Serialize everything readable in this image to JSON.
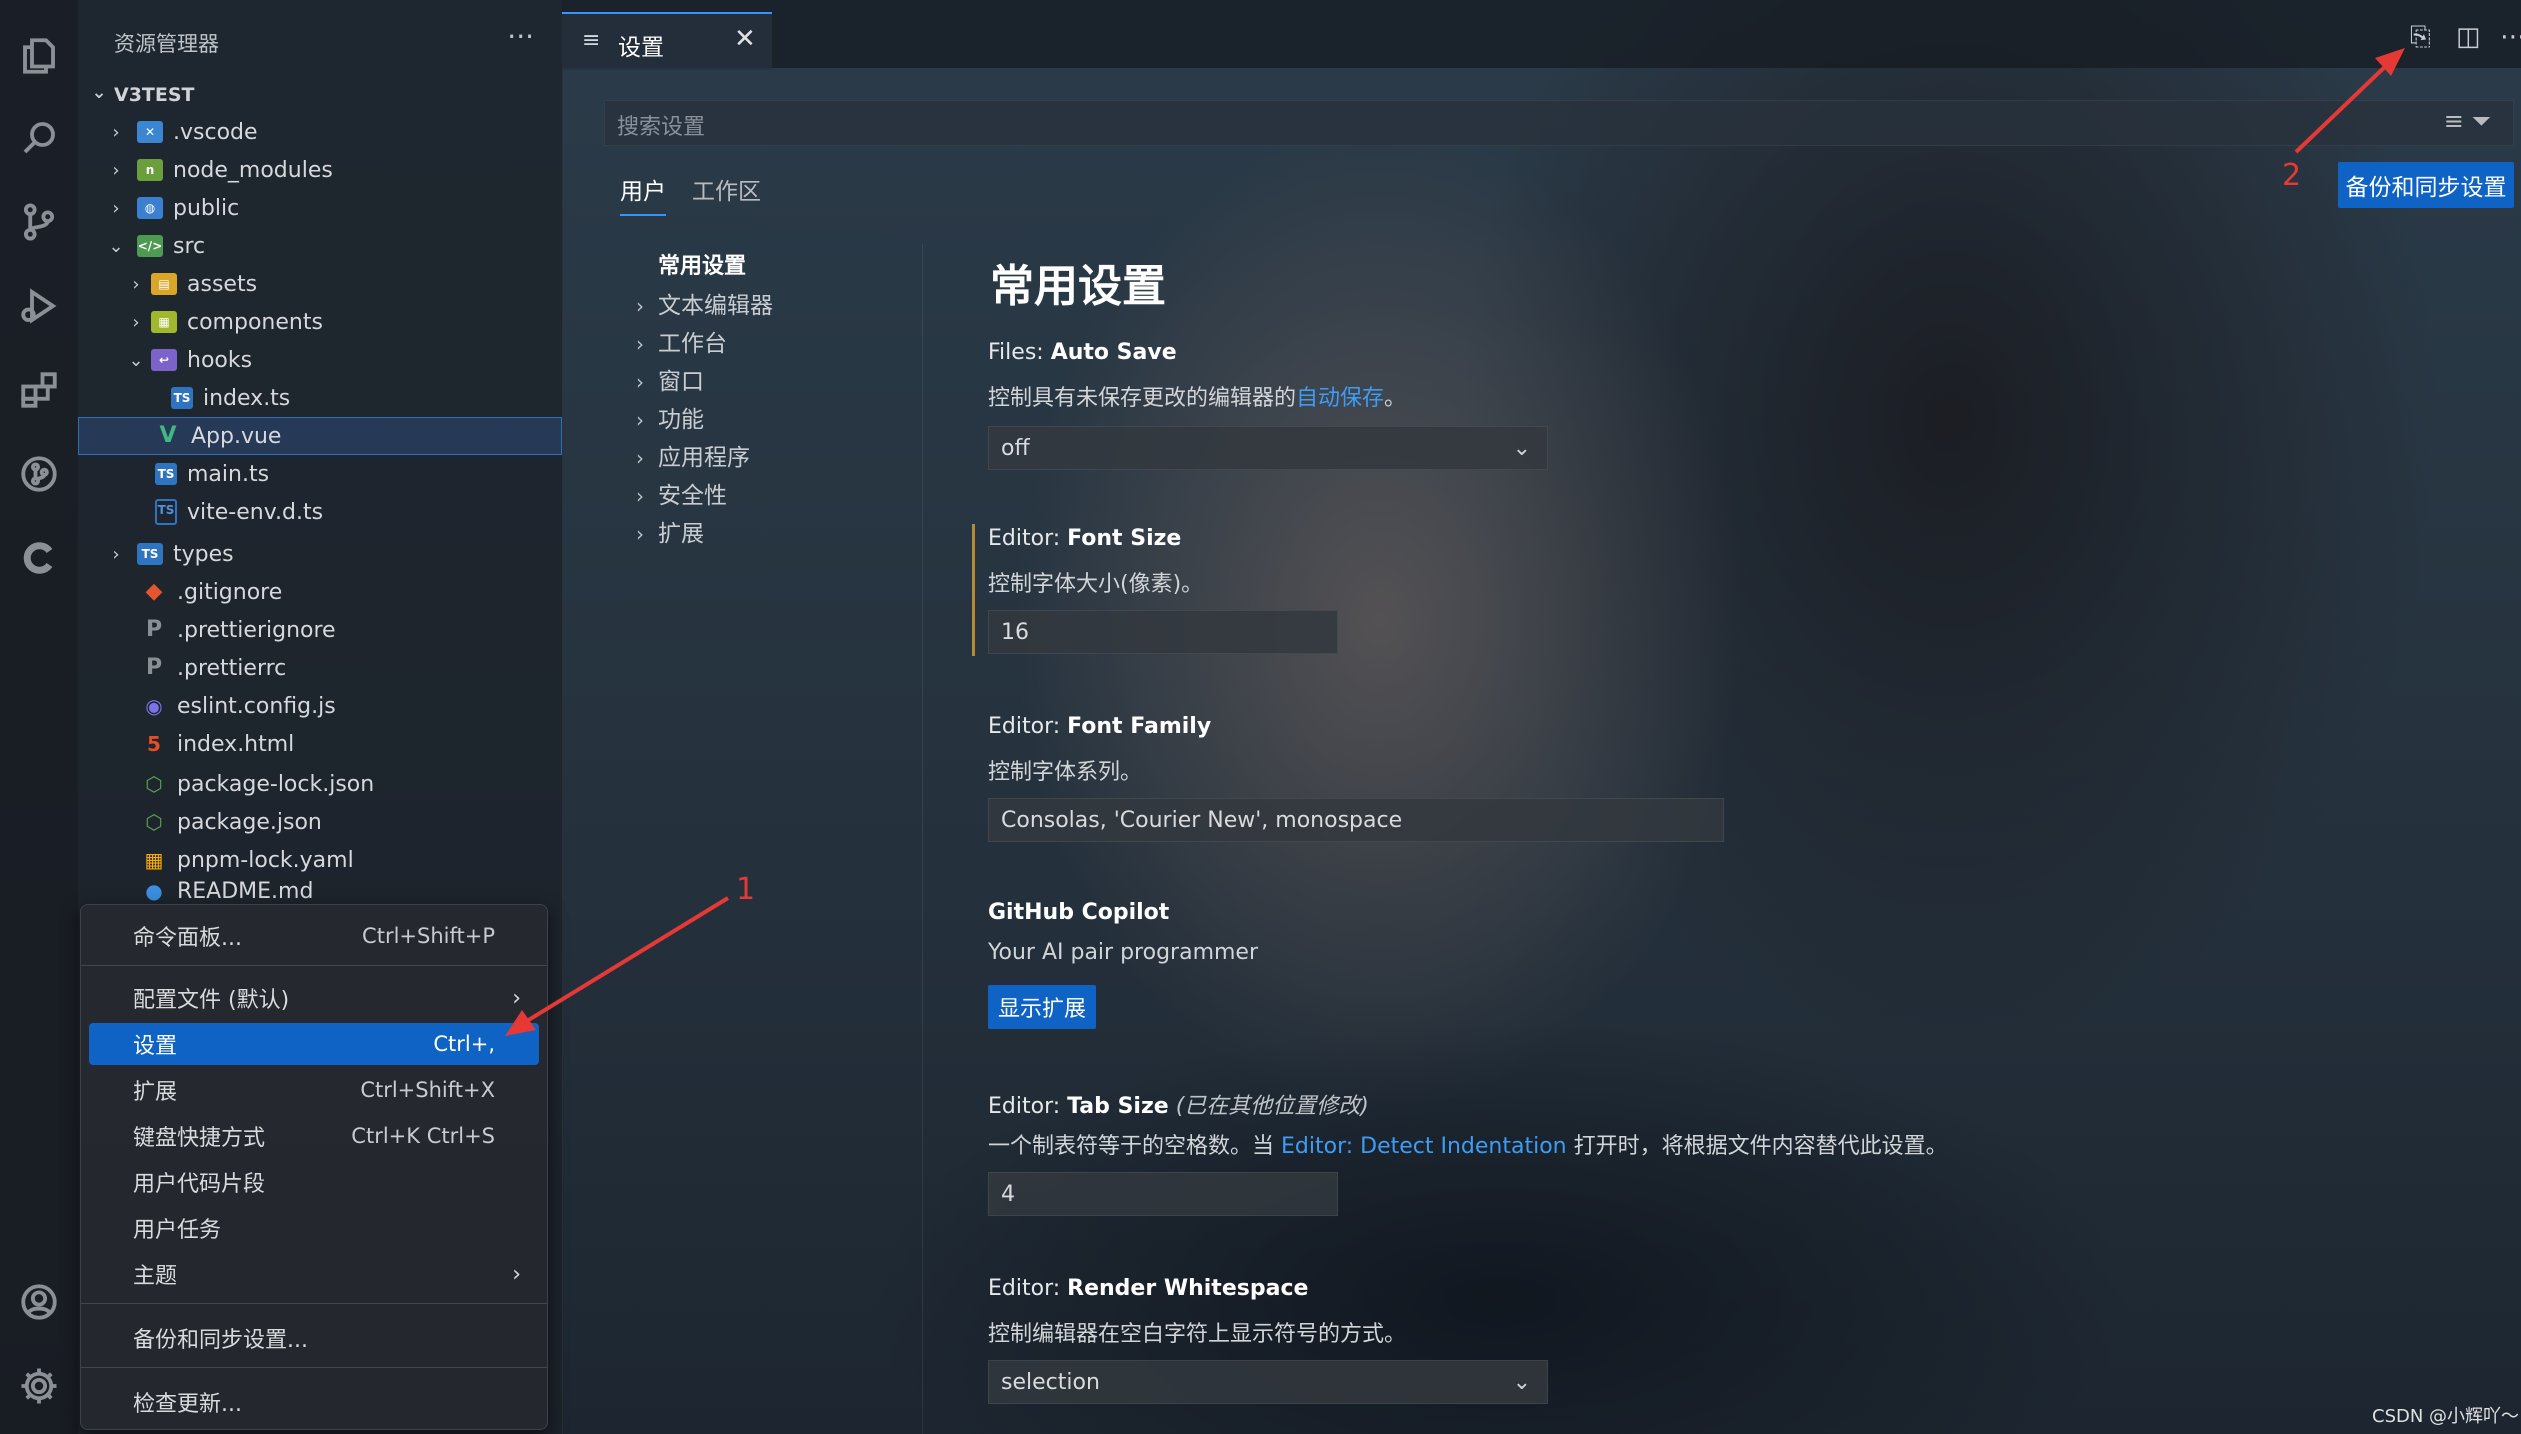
{
  "explorer": {
    "title": "资源管理器",
    "more": "···",
    "root": "V3TEST",
    "items": [
      {
        "label": ".vscode"
      },
      {
        "label": "node_modules"
      },
      {
        "label": "public"
      },
      {
        "label": "src"
      },
      {
        "label": "assets"
      },
      {
        "label": "components"
      },
      {
        "label": "hooks"
      },
      {
        "label": "index.ts"
      },
      {
        "label": "App.vue"
      },
      {
        "label": "main.ts"
      },
      {
        "label": "vite-env.d.ts"
      },
      {
        "label": "types"
      },
      {
        "label": ".gitignore"
      },
      {
        "label": ".prettierignore"
      },
      {
        "label": ".prettierrc"
      },
      {
        "label": "eslint.config.js"
      },
      {
        "label": "index.html"
      },
      {
        "label": "package-lock.json"
      },
      {
        "label": "package.json"
      },
      {
        "label": "pnpm-lock.yaml"
      },
      {
        "label": "README.md"
      }
    ]
  },
  "menu": {
    "items": [
      {
        "label": "命令面板...",
        "key": "Ctrl+Shift+P"
      },
      {
        "label": "配置文件 (默认)",
        "key": ""
      },
      {
        "label": "设置",
        "key": "Ctrl+,"
      },
      {
        "label": "扩展",
        "key": "Ctrl+Shift+X"
      },
      {
        "label": "键盘快捷方式",
        "key": "Ctrl+K Ctrl+S"
      },
      {
        "label": "用户代码片段",
        "key": ""
      },
      {
        "label": "用户任务",
        "key": ""
      },
      {
        "label": "主题",
        "key": ""
      },
      {
        "label": "备份和同步设置...",
        "key": ""
      },
      {
        "label": "检查更新...",
        "key": ""
      }
    ],
    "submenu_glyph": "›"
  },
  "tab": {
    "label": "设置",
    "icon": "≡",
    "close": "✕"
  },
  "settings": {
    "search_placeholder": "搜索设置",
    "scope_tabs": [
      "用户",
      "工作区"
    ],
    "sync_button": "备份和同步设置",
    "toc": {
      "active": "常用设置",
      "items": [
        "文本编辑器",
        "工作台",
        "窗口",
        "功能",
        "应用程序",
        "安全性",
        "扩展"
      ]
    },
    "section_title": "常用设置",
    "entries": {
      "autosave": {
        "category": "Files:",
        "name": "Auto Save",
        "desc_pre": "控制具有未保存更改的编辑器的",
        "desc_link": "自动保存",
        "desc_post": "。",
        "value": "off"
      },
      "fontsize": {
        "category": "Editor:",
        "name": "Font Size",
        "desc": "控制字体大小(像素)。",
        "value": "16"
      },
      "fontfamily": {
        "category": "Editor:",
        "name": "Font Family",
        "desc": "控制字体系列。",
        "value": "Consolas, 'Courier New', monospace"
      },
      "copilot": {
        "name": "GitHub Copilot",
        "desc": "Your AI pair programmer",
        "button": "显示扩展"
      },
      "tabsize": {
        "category": "Editor:",
        "name": "Tab Size",
        "note": "(已在其他位置修改)",
        "desc_pre": "一个制表符等于的空格数。当",
        "desc_link": "Editor: Detect Indentation",
        "desc_post": "打开时，将根据文件内容替代此设置。",
        "value": "4"
      },
      "whitespace": {
        "category": "Editor:",
        "name": "Render Whitespace",
        "desc": "控制编辑器在空白字符上显示符号的方式。",
        "value": "selection"
      }
    }
  },
  "annotations": {
    "one": "1",
    "two": "2"
  },
  "watermark": "CSDN @小辉吖～",
  "colors": {
    "accent": "#0e63c4",
    "link": "#3f9cf3",
    "arrow": "#e53935",
    "modified": "#b58a35"
  }
}
